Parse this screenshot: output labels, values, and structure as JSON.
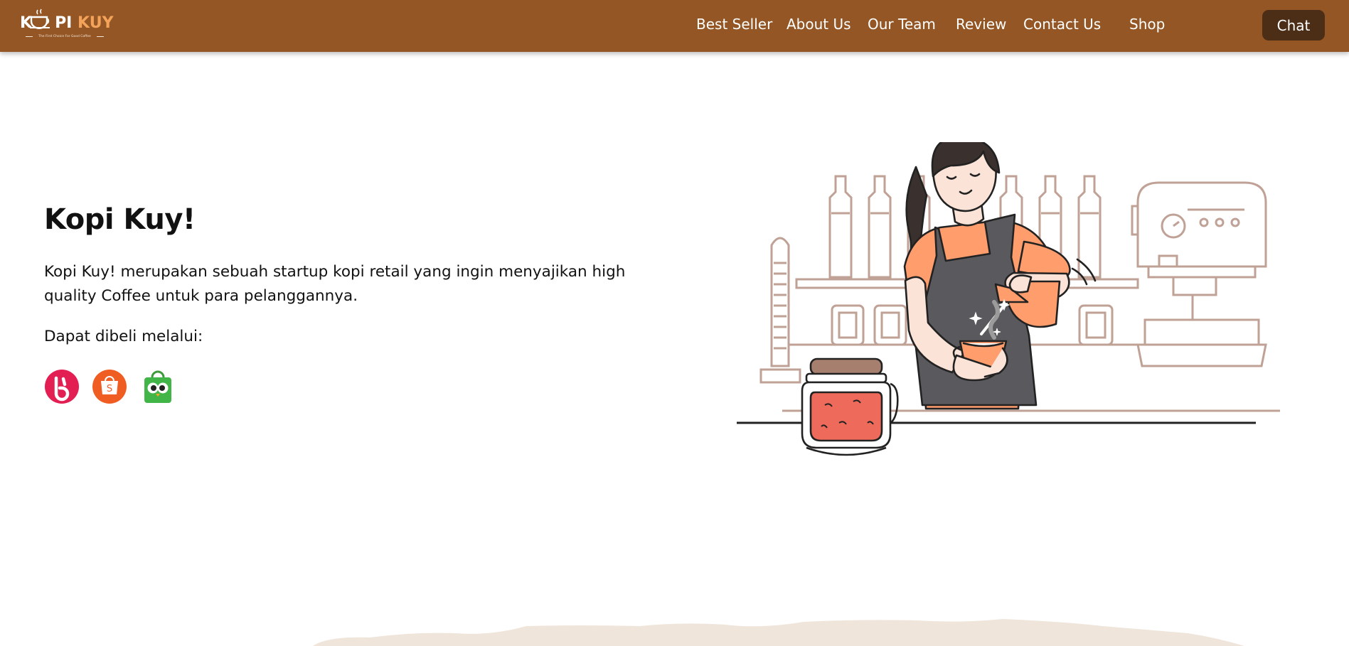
{
  "header": {
    "logo": {
      "k": "K",
      "pi": "PI",
      "kuy": "KUY",
      "tagline": "The First Choice For Good Coffee"
    },
    "nav": [
      {
        "label": "Best Seller"
      },
      {
        "label": "About Us"
      },
      {
        "label": "Our Team"
      },
      {
        "label": "Review"
      },
      {
        "label": "Contact Us"
      },
      {
        "label": "Shop"
      }
    ],
    "chat_label": "Chat"
  },
  "hero": {
    "title": "Kopi Kuy!",
    "description": "Kopi Kuy! merupakan sebuah startup kopi retail yang ingin menyajikan high quality Coffee untuk para pelanggannya.",
    "buy_label": "Dapat dibeli melalui:",
    "stores": [
      {
        "icon": "bukalapak-icon"
      },
      {
        "icon": "shopee-icon"
      },
      {
        "icon": "tokopedia-icon"
      }
    ]
  },
  "colors": {
    "header_bg": "#935624",
    "chat_button_bg": "#4c2e16",
    "logo_accent": "#f4a35a",
    "illustration_line": "#bfa196",
    "apron": "#5a5a5e",
    "shirt": "#ff9d6c"
  }
}
